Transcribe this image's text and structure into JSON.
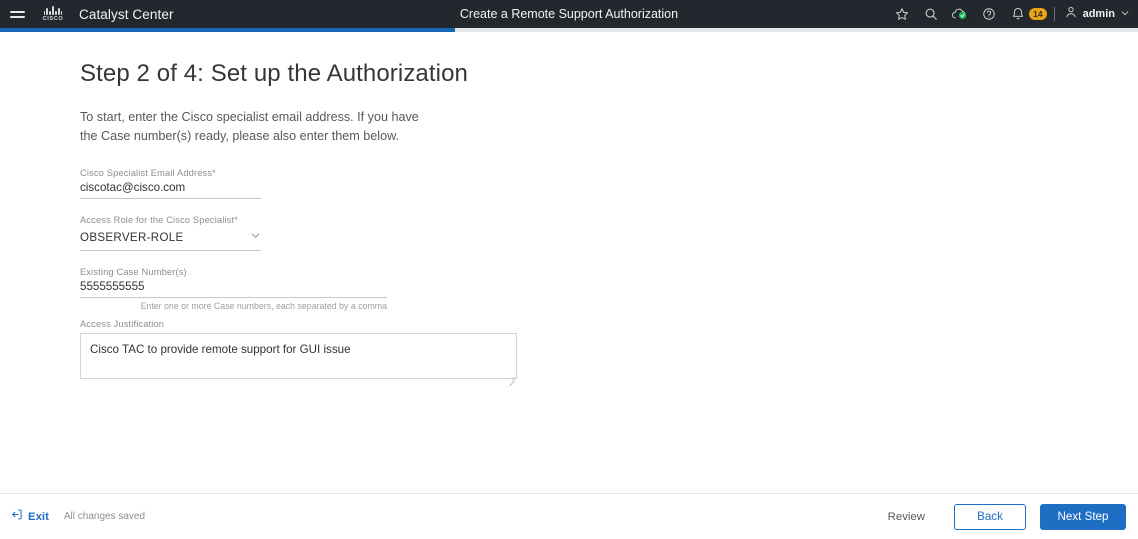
{
  "header": {
    "menu_icon": "hamburger-menu-icon",
    "brand_logo": "cisco-logo",
    "brand_wordmark": "CISCO",
    "app_name": "Catalyst Center",
    "page_context_title": "Create a Remote Support Authorization",
    "icons": [
      {
        "name": "favorite-star-icon",
        "glyph": "star"
      },
      {
        "name": "search-icon",
        "glyph": "magnifier"
      },
      {
        "name": "cloud-status-icon",
        "glyph": "cloud-check"
      },
      {
        "name": "help-icon",
        "glyph": "question-circle"
      },
      {
        "name": "notifications-bell-icon",
        "glyph": "bell"
      }
    ],
    "notification_count": "14",
    "user_name": "admin",
    "user_menu_icon": "chevron-down-icon",
    "avatar_icon": "user-avatar-icon"
  },
  "progress": {
    "percent": 40,
    "fill_color": "#1766b4",
    "track_color": "#e3e5e6"
  },
  "main": {
    "title": "Step 2 of 4: Set up the Authorization",
    "description": "To start, enter the Cisco specialist email address. If you have the Case number(s) ready, please also enter them below.",
    "fields": {
      "email": {
        "label": "Cisco Specialist Email Address*",
        "value": "ciscotac@cisco.com",
        "placeholder": ""
      },
      "role": {
        "label": "Access Role for the Cisco Specialist*",
        "value": "OBSERVER-ROLE",
        "options": [
          "OBSERVER-ROLE"
        ],
        "chevron_icon": "chevron-down-icon"
      },
      "case_numbers": {
        "label": "Existing Case Number(s)",
        "value": "5555555555",
        "placeholder": "",
        "hint": "Enter one or more Case numbers, each separated by a comma"
      },
      "justification": {
        "label": "Access Justification",
        "value": "Cisco TAC to provide remote support for GUI issue",
        "placeholder": ""
      }
    }
  },
  "footer": {
    "exit_label": "Exit",
    "exit_icon": "exit-arrow-icon",
    "status_text": "All changes saved",
    "review_label": "Review",
    "back_label": "Back",
    "next_label": "Next Step"
  },
  "colors": {
    "header_bg": "#23282e",
    "primary_blue": "#1e6fc4",
    "progress_blue": "#1766b4",
    "badge_amber": "#e8a411",
    "status_green": "#1db954"
  }
}
